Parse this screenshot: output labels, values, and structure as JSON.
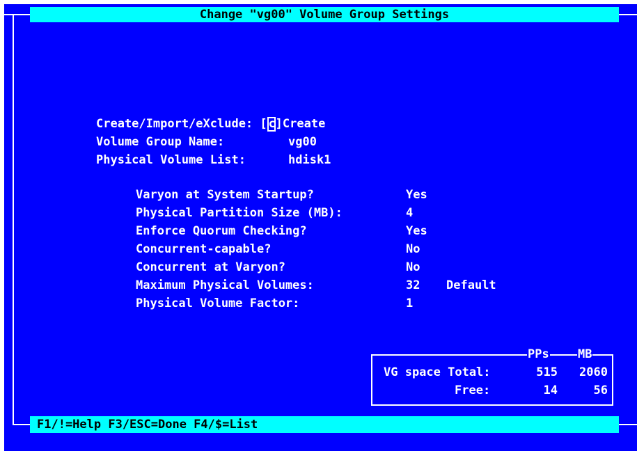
{
  "title": "Change \"vg00\" Volume Group Settings",
  "main": {
    "create_label": "Create/Import/eXclude:",
    "create_bracket_open": "[",
    "create_value": "c",
    "create_bracket_close": "]",
    "create_text": "Create",
    "vg_name_label": "Volume Group Name:",
    "vg_name_value": "vg00",
    "pv_list_label": "Physical Volume List:",
    "pv_list_value": "hdisk1"
  },
  "settings": [
    {
      "label": "Varyon at System Startup?",
      "value": "Yes",
      "extra": ""
    },
    {
      "label": "Physical Partition Size (MB):",
      "value": "4",
      "extra": ""
    },
    {
      "label": "Enforce Quorum Checking?",
      "value": "Yes",
      "extra": ""
    },
    {
      "label": "Concurrent-capable?",
      "value": "No",
      "extra": ""
    },
    {
      "label": "Concurrent at Varyon?",
      "value": "No",
      "extra": ""
    },
    {
      "label": "Maximum Physical Volumes:",
      "value": "32",
      "extra": "Default"
    },
    {
      "label": "Physical Volume Factor:",
      "value": "1",
      "extra": ""
    }
  ],
  "space_box": {
    "col_pps": "PPs",
    "col_mb": "MB",
    "total_label": "VG space Total:",
    "total_pps": "515",
    "total_mb": "2060",
    "free_label": "Free:",
    "free_pps": "14",
    "free_mb": "56"
  },
  "footer": {
    "text": "F1/!=Help  F3/ESC=Done  F4/$=List"
  },
  "colors": {
    "background": "#0000ff",
    "bar": "#00ffff",
    "text": "#ffffff"
  }
}
